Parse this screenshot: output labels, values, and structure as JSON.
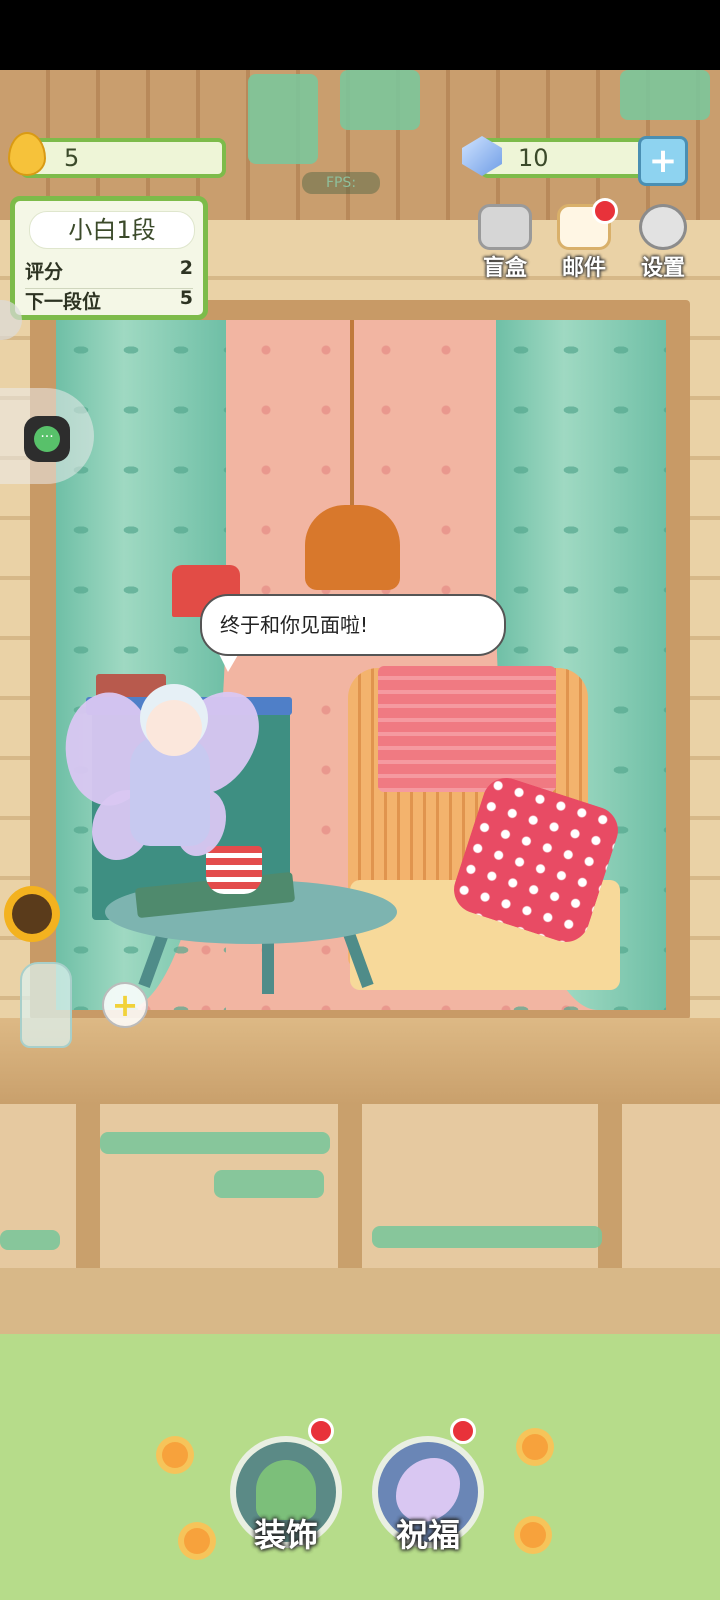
{
  "resources": {
    "water": {
      "icon": "water-drop-icon",
      "value": "5"
    },
    "gems": {
      "icon": "gem-icon",
      "value": "10"
    }
  },
  "fps_label": "FPS:",
  "rank": {
    "title": "小白1段",
    "score_label": "评分",
    "score_value": "2",
    "next_label": "下一段位",
    "next_value": "5"
  },
  "top_buttons": [
    {
      "icon": "gift-box-icon",
      "label": "盲盒",
      "badge": false
    },
    {
      "icon": "mail-icon",
      "label": "邮件",
      "badge": true
    },
    {
      "icon": "gear-icon",
      "label": "设置",
      "badge": false
    }
  ],
  "speech": "终于和你见面啦!",
  "bottom_buttons": [
    {
      "icon": "plant-icon",
      "label": "装饰",
      "badge": true
    },
    {
      "icon": "fairy-icon",
      "label": "祝福",
      "badge": true
    }
  ],
  "colors": {
    "accent_green": "#7dbb4a",
    "badge_red": "#e8323a"
  }
}
